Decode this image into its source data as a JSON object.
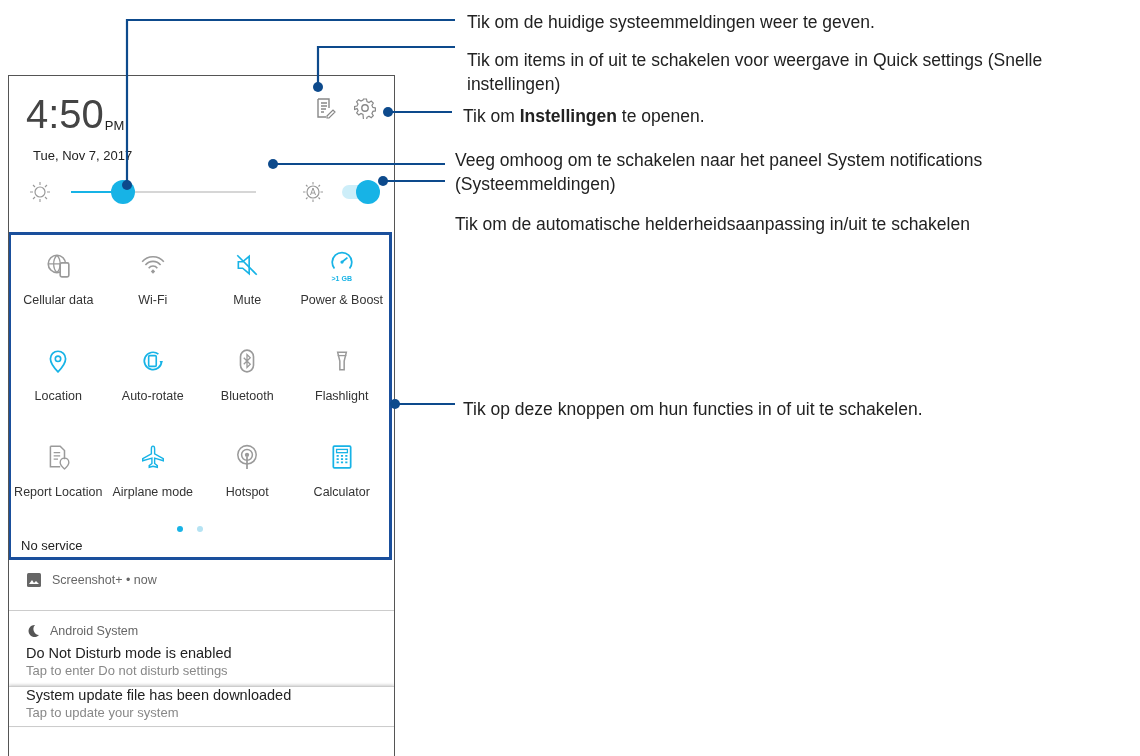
{
  "callouts": [
    {
      "text": "Tik om de huidige systeemmeldingen weer te geven."
    },
    {
      "text": "Tik om items in of uit te schakelen voor weergave in Quick settings (Snelle instellingen)"
    },
    {
      "text": "Tik om **Instellingen** te openen."
    },
    {
      "text": "Veeg omhoog om te schakelen naar het paneel System notifications (Systeemmeldingen)"
    },
    {
      "text": "Tik om de automatische helderheidsaanpassing in/uit te schakelen"
    },
    {
      "text": "Tik op deze knoppen om hun functies in of uit te schakelen."
    }
  ],
  "header": {
    "time": "4:50",
    "ampm": "PM",
    "date": "Tue, Nov 7, 2017"
  },
  "brightness": {
    "level": 0.28,
    "auto": true
  },
  "tiles": [
    {
      "label": "Cellular data",
      "on": false
    },
    {
      "label": "Wi-Fi",
      "on": false
    },
    {
      "label": "Mute",
      "on": true
    },
    {
      "label": "Power & Boost",
      "on": true,
      "badge": ">1 GB"
    },
    {
      "label": "Location",
      "on": true
    },
    {
      "label": "Auto-rotate",
      "on": true
    },
    {
      "label": "Bluetooth",
      "on": false
    },
    {
      "label": "Flashlight",
      "on": false
    },
    {
      "label": "Report Location",
      "on": false
    },
    {
      "label": "Airplane mode",
      "on": true
    },
    {
      "label": "Hotspot",
      "on": false
    },
    {
      "label": "Calculator",
      "on": true
    }
  ],
  "pages": [
    {
      "selected": true
    },
    {
      "selected": false
    }
  ],
  "network_status": "No service",
  "notifications": [
    {
      "kind": "app",
      "app": "Screenshot+ • now"
    },
    {
      "kind": "full",
      "app": "Android System",
      "title": "Do Not Disturb mode is enabled",
      "text": "Tap to enter Do not disturb settings"
    },
    {
      "kind": "stacked",
      "title": "System update file has been downloaded",
      "text": "Tap to update your system"
    }
  ]
}
